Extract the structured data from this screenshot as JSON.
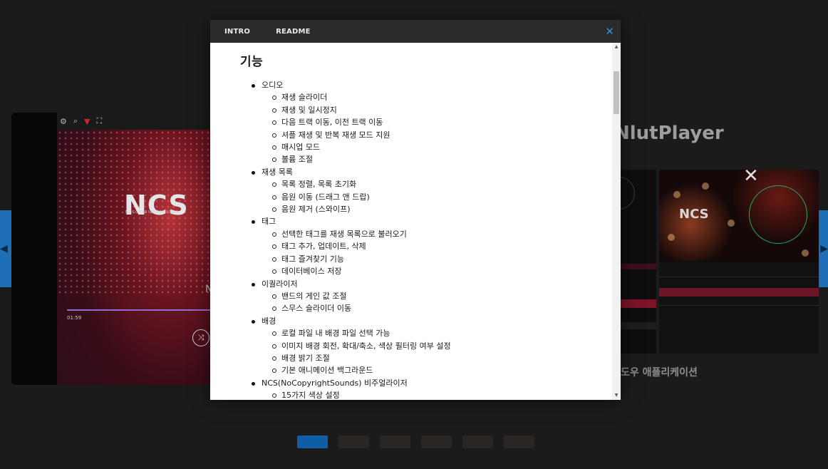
{
  "background": {
    "left_card": {
      "toolbar_icons": [
        "gear-icon",
        "search-icon",
        "filter-icon",
        "fullscreen-icon"
      ],
      "logo_text": "NCS",
      "logo_subtext": "NOCOPYRIGHTSOUNDS",
      "time": "01:59",
      "partial_letter": "N"
    },
    "right_card": {
      "title": "NlutPlayer",
      "subtitle": "도우 애플리케이션",
      "logo_text": "NCS"
    },
    "carousel_dots": 6,
    "active_dot": 0
  },
  "modal": {
    "tabs": [
      "INTRO",
      "README"
    ],
    "close_label": "✕",
    "heading": "기능",
    "sections": [
      {
        "title": "오디오",
        "items": [
          "재생 슬라이더",
          "재생 및 일시정지",
          "다음 트랙 이동, 이전 트랙 이동",
          "셔플 재생 및 반복 재생 모드 지원",
          "매시업 모드",
          "볼륨 조절"
        ]
      },
      {
        "title": "재생 목록",
        "items": [
          "목록 정렬, 목록 초기화",
          "음원 이동 (드래그 앤 드랍)",
          "음원 제거 (스와이프)"
        ]
      },
      {
        "title": "태그",
        "items": [
          "선택한 태그를 재생 목록으로 불러오기",
          "태그 추가, 업데이트, 삭제",
          "태그 즐겨찾기 기능",
          "데이터베이스 저장"
        ]
      },
      {
        "title": "이퀄라이저",
        "items": [
          "밴드의 게인 값 조절",
          "스무스 슬라이더 이동"
        ]
      },
      {
        "title": "배경",
        "items": [
          "로컬 파일 내 배경 파일 선택 가능",
          "이미지 배경 회전, 확대/축소, 색상 필터링 여부 설정",
          "배경 밝기 조절",
          "기본 애니메이션 백그라운드"
        ]
      },
      {
        "title": "NCS(NoCopyrightSounds) 비주얼라이저",
        "items": [
          "15가지 색상 설정"
        ]
      }
    ]
  }
}
